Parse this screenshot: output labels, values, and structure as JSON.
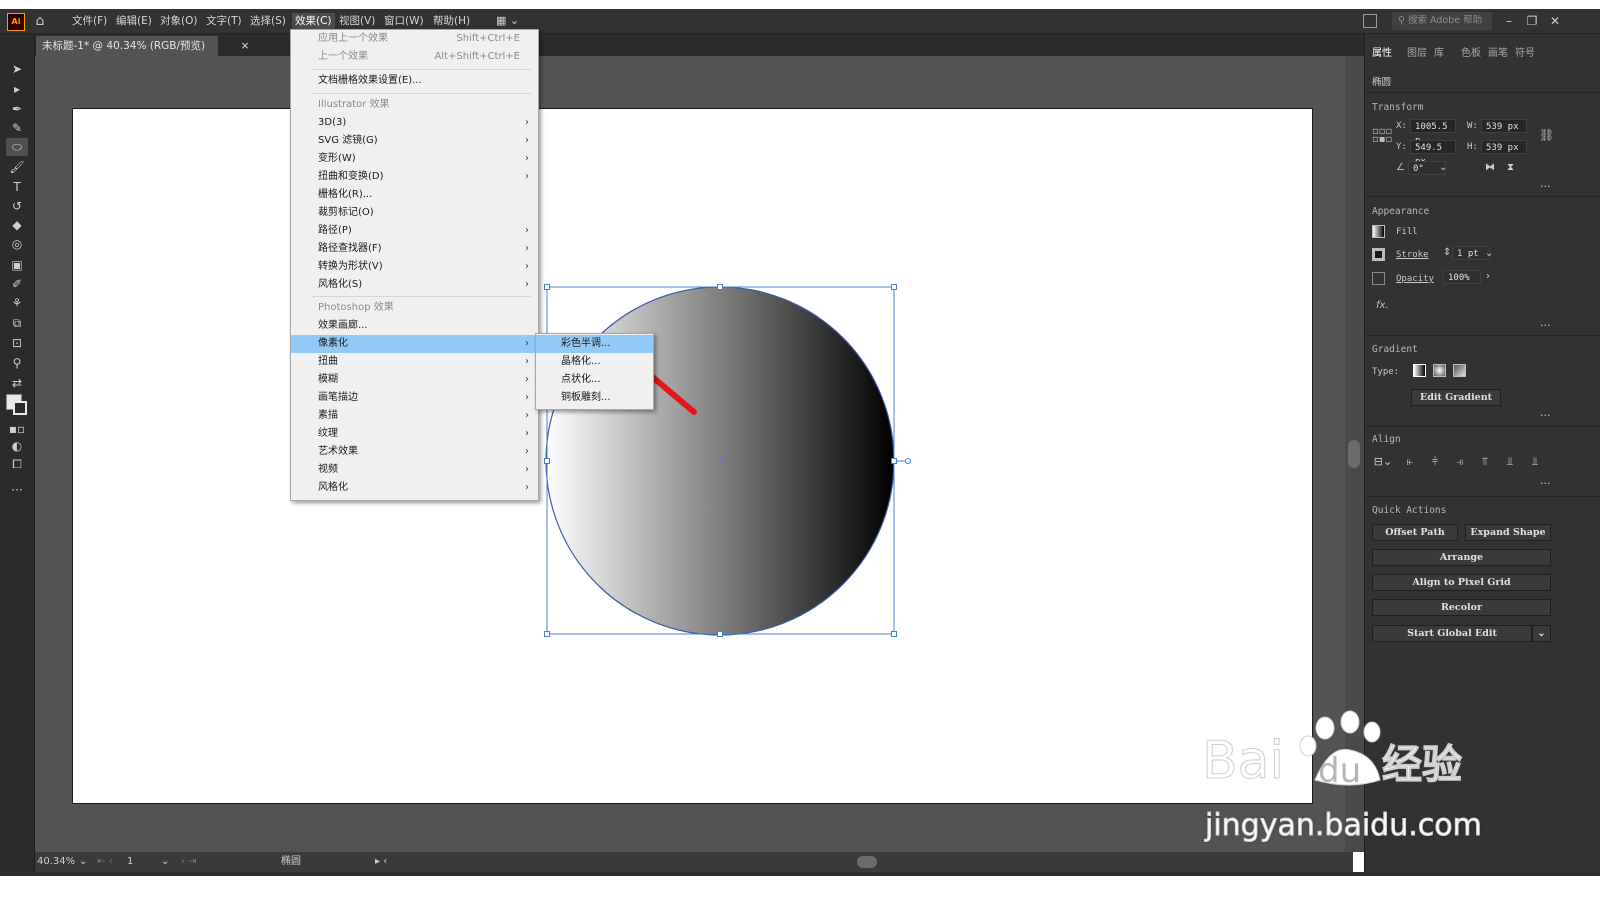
{
  "app": {
    "logo_text": "Ai"
  },
  "menubar": {
    "items": [
      "文件(F)",
      "编辑(E)",
      "对象(O)",
      "文字(T)",
      "选择(S)",
      "效果(C)",
      "视图(V)",
      "窗口(W)",
      "帮助(H)"
    ],
    "active_index": 5,
    "search_placeholder": "搜索 Adobe 帮助"
  },
  "document": {
    "tab_title": "未标题-1* @ 40.34% (RGB/预览)",
    "tab_close": "×"
  },
  "effect_menu": {
    "apply_last": {
      "label": "应用上一个效果",
      "shortcut": "Shift+Ctrl+E"
    },
    "last_effect": {
      "label": "上一个效果",
      "shortcut": "Alt+Shift+Ctrl+E"
    },
    "raster_settings": "文档栅格效果设置(E)...",
    "illustrator_header": "Illustrator 效果",
    "illustrator_items": [
      "3D(3)",
      "SVG 滤镜(G)",
      "变形(W)",
      "扭曲和变换(D)",
      "栅格化(R)...",
      "裁剪标记(O)",
      "路径(P)",
      "路径查找器(F)",
      "转换为形状(V)",
      "风格化(S)"
    ],
    "photoshop_header": "Photoshop 效果",
    "photoshop_items": [
      "效果画廊...",
      "像素化",
      "扭曲",
      "模糊",
      "画笔描边",
      "素描",
      "纹理",
      "艺术效果",
      "视频",
      "风格化"
    ],
    "highlighted": "像素化"
  },
  "pixelate_submenu": {
    "items": [
      "彩色半调...",
      "晶格化...",
      "点状化...",
      "铜板雕刻..."
    ],
    "highlighted_index": 0
  },
  "statusbar": {
    "zoom": "40.34%",
    "artboard_number": "1",
    "current_tool": "椭圆"
  },
  "properties_panel": {
    "tabs": [
      "属性",
      "图层",
      "库",
      "色板",
      "画笔",
      "符号"
    ],
    "active_tab": "属性",
    "selection_type": "椭圆",
    "transform": {
      "title": "Transform",
      "x_label": "X:",
      "x": "1005.5 p",
      "y_label": "Y:",
      "y": "549.5 px",
      "w_label": "W:",
      "w": "539 px",
      "h_label": "H:",
      "h": "539 px",
      "angle": "0°"
    },
    "appearance": {
      "title": "Appearance",
      "fill_label": "Fill",
      "stroke_label": "Stroke",
      "stroke_weight": "1 pt",
      "opacity_label": "Opacity",
      "opacity": "100%",
      "fx_label": "fx."
    },
    "gradient": {
      "title": "Gradient",
      "type_label": "Type:",
      "edit_button": "Edit Gradient"
    },
    "align": {
      "title": "Align"
    },
    "quick_actions": {
      "title": "Quick Actions",
      "offset_path": "Offset Path",
      "expand_shape": "Expand Shape",
      "arrange": "Arrange",
      "align_pixel": "Align to Pixel Grid",
      "recolor": "Recolor",
      "global_edit": "Start Global Edit"
    }
  },
  "watermark": {
    "brand": "Bai",
    "du": "du",
    "cn": "经验",
    "url": "jingyan.baidu.com"
  },
  "colors": {
    "menu_highlight": "#91c9f7",
    "selection_bbox": "#4a7fd4",
    "arrow": "#e8141c",
    "app_orange": "#ff9a00"
  }
}
